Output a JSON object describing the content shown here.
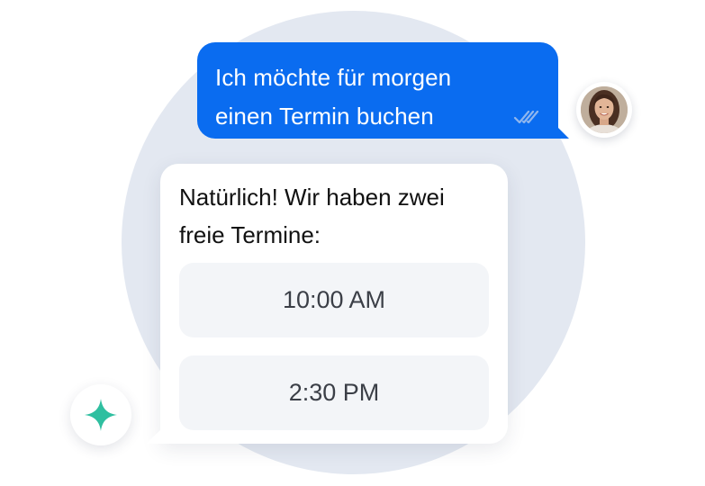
{
  "user_message": {
    "line1": "Ich möchte für morgen",
    "line2": "einen Termin buchen",
    "status_icon": "double-check-icon",
    "bubble_color": "#0a6cf0"
  },
  "user_avatar": {
    "icon": "user-avatar-photo"
  },
  "bot_message": {
    "line1": "Natürlich! Wir haben zwei",
    "line2": "freie Termine:",
    "options": [
      {
        "label": "10:00 AM"
      },
      {
        "label": "2:30 PM"
      }
    ]
  },
  "assistant_badge": {
    "icon": "sparkle-icon",
    "color": "#2fbfa0"
  }
}
